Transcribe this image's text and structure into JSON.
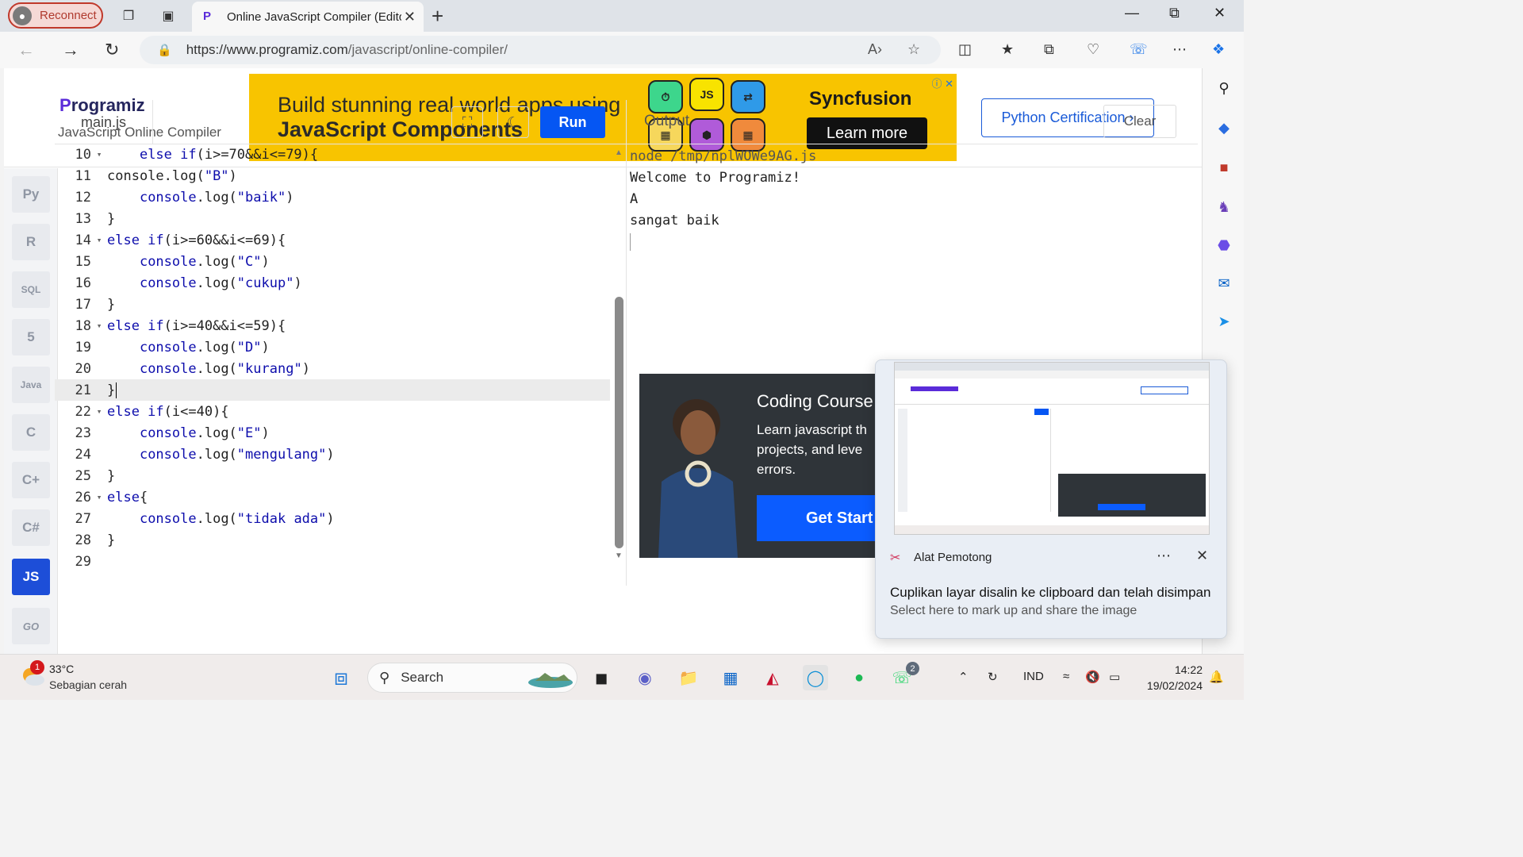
{
  "browser": {
    "reconnect_label": "Reconnect",
    "tab_title": "Online JavaScript Compiler (Edito",
    "url_host": "https://www.programiz.com",
    "url_path": "/javascript/online-compiler/"
  },
  "header": {
    "logo_text": "rogramiz",
    "logo_p": "P",
    "subtitle": "JavaScript Online Compiler",
    "cert_button": "Python Certification ›"
  },
  "ad": {
    "line1": "Build stunning real world apps using",
    "line2": "JavaScript Components",
    "tile_js": "JS",
    "brand": "Syncfusion",
    "cta": "Learn more"
  },
  "rail": {
    "items": [
      "Py",
      "R",
      "SQL",
      "5",
      "Java",
      "C",
      "C+",
      "C#",
      "JS",
      "GO"
    ]
  },
  "editor": {
    "file_tab": "main.js",
    "run_label": "Run",
    "lines": [
      {
        "n": "10",
        "fold": true,
        "indent": "    ",
        "parts": [
          [
            "kw",
            "else if"
          ],
          [
            "t",
            "(i>=70&&i<=79){"
          ]
        ]
      },
      {
        "n": "11",
        "fold": false,
        "indent": "",
        "parts": [
          [
            "t",
            "console.log("
          ],
          [
            "s",
            "\"B\""
          ],
          [
            "t",
            ")"
          ]
        ]
      },
      {
        "n": "12",
        "fold": false,
        "indent": "    ",
        "parts": [
          [
            "kw",
            "console"
          ],
          [
            "t",
            ".log("
          ],
          [
            "s",
            "\"baik\""
          ],
          [
            "t",
            ")"
          ]
        ]
      },
      {
        "n": "13",
        "fold": false,
        "indent": "",
        "parts": [
          [
            "t",
            "}"
          ]
        ]
      },
      {
        "n": "14",
        "fold": true,
        "indent": "",
        "parts": [
          [
            "kw",
            "else if"
          ],
          [
            "t",
            "(i>=60&&i<=69){"
          ]
        ]
      },
      {
        "n": "15",
        "fold": false,
        "indent": "    ",
        "parts": [
          [
            "kw",
            "console"
          ],
          [
            "t",
            ".log("
          ],
          [
            "s",
            "\"C\""
          ],
          [
            "t",
            ")"
          ]
        ]
      },
      {
        "n": "16",
        "fold": false,
        "indent": "    ",
        "parts": [
          [
            "kw",
            "console"
          ],
          [
            "t",
            ".log("
          ],
          [
            "s",
            "\"cukup\""
          ],
          [
            "t",
            ")"
          ]
        ]
      },
      {
        "n": "17",
        "fold": false,
        "indent": "",
        "parts": [
          [
            "t",
            "}"
          ]
        ]
      },
      {
        "n": "18",
        "fold": true,
        "indent": "",
        "parts": [
          [
            "kw",
            "else if"
          ],
          [
            "t",
            "(i>=40&&i<=59){"
          ]
        ]
      },
      {
        "n": "19",
        "fold": false,
        "indent": "    ",
        "parts": [
          [
            "kw",
            "console"
          ],
          [
            "t",
            ".log("
          ],
          [
            "s",
            "\"D\""
          ],
          [
            "t",
            ")"
          ]
        ]
      },
      {
        "n": "20",
        "fold": false,
        "indent": "    ",
        "parts": [
          [
            "kw",
            "console"
          ],
          [
            "t",
            ".log("
          ],
          [
            "s",
            "\"kurang\""
          ],
          [
            "t",
            ")"
          ]
        ]
      },
      {
        "n": "21",
        "fold": false,
        "indent": "",
        "parts": [
          [
            "t",
            "}"
          ]
        ],
        "current": true
      },
      {
        "n": "22",
        "fold": true,
        "indent": "",
        "parts": [
          [
            "kw",
            "else if"
          ],
          [
            "t",
            "(i<=40){"
          ]
        ]
      },
      {
        "n": "23",
        "fold": false,
        "indent": "    ",
        "parts": [
          [
            "kw",
            "console"
          ],
          [
            "t",
            ".log("
          ],
          [
            "s",
            "\"E\""
          ],
          [
            "t",
            ")"
          ]
        ]
      },
      {
        "n": "24",
        "fold": false,
        "indent": "    ",
        "parts": [
          [
            "kw",
            "console"
          ],
          [
            "t",
            ".log("
          ],
          [
            "s",
            "\"mengulang\""
          ],
          [
            "t",
            ")"
          ]
        ]
      },
      {
        "n": "25",
        "fold": false,
        "indent": "",
        "parts": [
          [
            "t",
            "}"
          ]
        ]
      },
      {
        "n": "26",
        "fold": true,
        "indent": "",
        "parts": [
          [
            "kw",
            "else"
          ],
          [
            "t",
            "{"
          ]
        ]
      },
      {
        "n": "27",
        "fold": false,
        "indent": "    ",
        "parts": [
          [
            "kw",
            "console"
          ],
          [
            "t",
            ".log("
          ],
          [
            "s",
            "\"tidak ada\""
          ],
          [
            "t",
            ")"
          ]
        ]
      },
      {
        "n": "28",
        "fold": false,
        "indent": "",
        "parts": [
          [
            "t",
            "}"
          ]
        ]
      },
      {
        "n": "29",
        "fold": false,
        "indent": "",
        "parts": []
      }
    ]
  },
  "output": {
    "title": "Output",
    "clear_label": "Clear",
    "lines": [
      "node /tmp/nplWOWe9AG.js",
      "Welcome to Programiz!",
      "A",
      "sangat baik"
    ]
  },
  "course_ad": {
    "heading": "Coding Course",
    "body": "Learn javascript th projects, and leve errors.",
    "cta": "Get Start"
  },
  "notification": {
    "app_name": "Alat Pemotong",
    "message": "Cuplikan layar disalin ke clipboard dan telah disimpan",
    "sub": "Select here to mark up and share the image"
  },
  "taskbar": {
    "weather_badge": "1",
    "temperature": "33°C",
    "weather_desc": "Sebagian cerah",
    "search_placeholder": "Search",
    "whatsapp_badge": "2",
    "language": "IND",
    "time": "14:22",
    "date": "19/02/2024"
  },
  "colors": {
    "run_button": "#0556f3",
    "active_rail": "#1d4ed8",
    "ad_background": "#f8c400",
    "accent_link": "#1a5bd8"
  }
}
